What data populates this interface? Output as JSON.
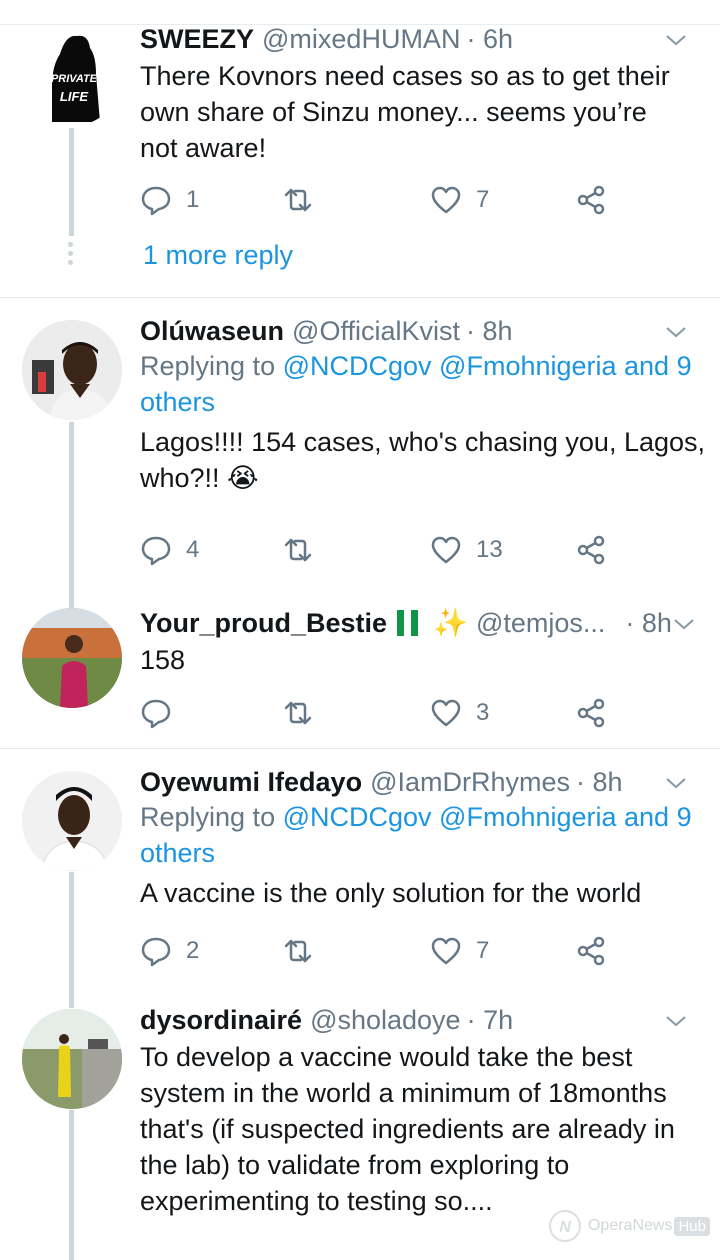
{
  "tweets": [
    {
      "name": "SWEEZY",
      "handle": "@mixedHUMAN",
      "time": "· 6h",
      "avatar_text": [
        "PRIVATE",
        "LIFE"
      ],
      "text": "There Kovnors need cases so as to get their own share of Sinzu money... seems you’re not aware!",
      "replies": "1",
      "retweets": "",
      "likes": "7",
      "more_replies": "1 more reply"
    },
    {
      "name": "Olúwaseun",
      "handle": "@OfficialKvist",
      "time": "· 8h",
      "reply_prefix": "Replying to",
      "reply_mentions": "@NCDCgov @Fmohnigeria and 9 others",
      "text": "Lagos!!!! 154 cases, who's chasing you, Lagos, who?!! 😭",
      "replies": "4",
      "retweets": "",
      "likes": "13"
    },
    {
      "name": "Your_proud_Bestie",
      "handle": "@temjos...",
      "time": "· 8h",
      "text": "158",
      "replies": "",
      "retweets": "",
      "likes": "3"
    },
    {
      "name": "Oyewumi Ifedayo",
      "handle": "@IamDrRhymes",
      "time": "· 8h",
      "reply_prefix": "Replying to",
      "reply_mentions": "@NCDCgov @Fmohnigeria and 9 others",
      "text": "A vaccine is the only solution for the world",
      "replies": "2",
      "retweets": "",
      "likes": "7"
    },
    {
      "name": "dysordinairé",
      "handle": "@sholadoye",
      "time": "· 7h",
      "text": "To develop a vaccine would take the best system in the world a minimum of 18months that's (if suspected ingredients are already in the lab) to validate from exploring to experimenting to testing so....",
      "replies": "",
      "retweets": "",
      "likes": ""
    }
  ],
  "watermark": {
    "text": "OperaNews",
    "hub": "Hub"
  },
  "colors": {
    "accent": "#1b95e0",
    "muted": "#657786",
    "line": "#ccd6dd"
  }
}
